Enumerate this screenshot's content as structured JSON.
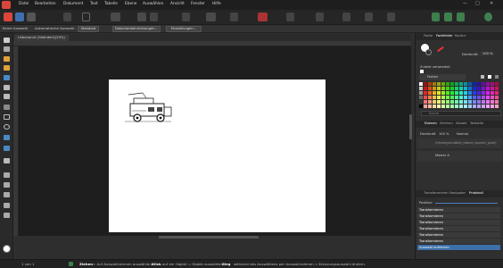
{
  "menu": [
    "Datei",
    "Bearbeiten",
    "Dokument",
    "Text",
    "Tabelle",
    "Ebene",
    "Auswählen",
    "Ansicht",
    "Fenster",
    "Hilfe"
  ],
  "window_controls": [
    "—",
    "□",
    "✕"
  ],
  "context": {
    "no_selection": "Keine Auswahl",
    "auto_select": "Automatische Auswahl:",
    "auto_select_value": "Standard",
    "doc_setup": "Dokumenteinrichtungen...",
    "settings": "Einstellungen..."
  },
  "document": {
    "tab_title": "Unbenannt (Geändert)(29%)"
  },
  "panel": {
    "top_tabs": [
      "Farbe",
      "Farbfelder",
      "Kontur"
    ],
    "opacity_label": "Deckkraft:",
    "opacity_value": "100 %",
    "recent_label": "Zuletzt verwendet:",
    "palette_name": "Farben",
    "search_placeholder": "Suche",
    "layer_tabs": [
      "Ebenen",
      "Zeichen",
      "Absatz",
      "Textstile"
    ],
    "layer_opts": [
      "Deckkraft",
      "100 %",
      "Normal"
    ],
    "layers": [
      "(Hintergrundbild_ebene_kopiert_pixel)",
      "Master A"
    ],
    "history_tabs": [
      "Transformieren",
      "Navigator",
      "Protokoll"
    ],
    "history_pos_label": "Position:",
    "history": [
      "Transformieren",
      "Transformieren",
      "Transformieren",
      "Transformieren",
      "Transformieren",
      "Transformieren",
      "Auswahl entfernen"
    ]
  },
  "status": {
    "page": "1 von 1",
    "hint_action": "Ziehen",
    "hint_1": "= Auf Auswahlrahmen auswählen.",
    "hint_click": "Klick",
    "hint_2": "auf ein Objekt = Objekt auswählen.",
    "hint_ctrl": "Strg",
    "hint_3": "während des Auswählens per Auswahlrahmen = Kreuzungsauswahl ändern."
  },
  "colors": {
    "accent": "#d9463b",
    "selected": "#3d6fa8"
  }
}
